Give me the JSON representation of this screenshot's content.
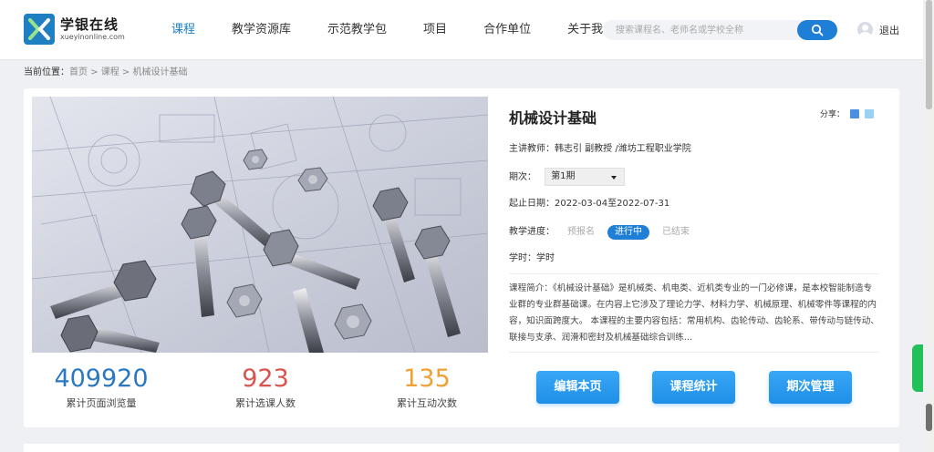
{
  "header": {
    "logo_title": "学银在线",
    "logo_sub": "xueyinonline.com",
    "nav": [
      {
        "label": "课程",
        "active": true
      },
      {
        "label": "教学资源库",
        "active": false
      },
      {
        "label": "示范教学包",
        "active": false
      },
      {
        "label": "项目",
        "active": false
      },
      {
        "label": "合作单位",
        "active": false
      },
      {
        "label": "关于我们",
        "active": false
      }
    ],
    "search_placeholder": "搜索课程名、老师名或学校全称",
    "logout_label": "退出"
  },
  "breadcrumb": {
    "lead": "当前位置：",
    "path": "首页 > 课程 > 机械设计基础"
  },
  "stats": [
    {
      "value": "409920",
      "label": "累计页面浏览量",
      "color": "#2b78c2"
    },
    {
      "value": "923",
      "label": "累计选课人数",
      "color": "#d9534f"
    },
    {
      "value": "135",
      "label": "累计互动次数",
      "color": "#f0a035"
    }
  ],
  "course": {
    "title": "机械设计基础",
    "share_label": "分享：",
    "teacher": "主讲教师：韩志引 副教授 /潍坊工程职业学院",
    "period_label": "期次：",
    "period_value": "第1期",
    "dates": "起止日期：2022-03-04至2022-07-31",
    "progress_label": "教学进度：",
    "progress_states": [
      "预报名",
      "进行中",
      "已结束"
    ],
    "progress_current": "进行中",
    "hours": "学时：学时",
    "description": "课程简介：《机械设计基础》是机械类、机电类、近机类专业的一门必修课，是本校智能制造专业群的专业群基础课。在内容上它涉及了理论力学、材料力学、机械原理、机械零件等课程的内容，知识面跨度大。 本课程的主要内容包括：常用机构、齿轮传动、齿轮系、带传动与链传动、联接与支承、润滑和密封及机械基础综合训练..."
  },
  "actions": {
    "edit": "编辑本页",
    "stats": "课程统计",
    "periods": "期次管理"
  },
  "colors": {
    "accent": "#1e7fc3",
    "button": "#1e8fe8"
  }
}
